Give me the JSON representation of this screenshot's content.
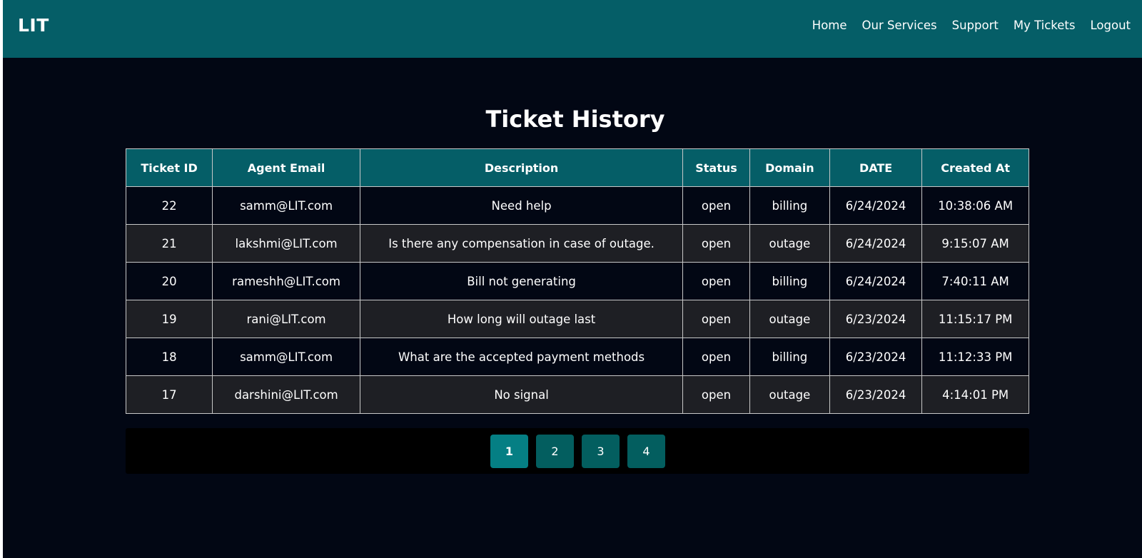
{
  "header": {
    "brand": "LIT",
    "nav": [
      "Home",
      "Our Services",
      "Support",
      "My Tickets",
      "Logout"
    ]
  },
  "main": {
    "title": "Ticket History",
    "columns": [
      "Ticket ID",
      "Agent Email",
      "Description",
      "Status",
      "Domain",
      "DATE",
      "Created At"
    ],
    "rows": [
      [
        "22",
        "samm@LIT.com",
        "Need help",
        "open",
        "billing",
        "6/24/2024",
        "10:38:06 AM"
      ],
      [
        "21",
        "lakshmi@LIT.com",
        "Is there any compensation in case of outage.",
        "open",
        "outage",
        "6/24/2024",
        "9:15:07 AM"
      ],
      [
        "20",
        "rameshh@LIT.com",
        "Bill not generating",
        "open",
        "billing",
        "6/24/2024",
        "7:40:11 AM"
      ],
      [
        "19",
        "rani@LIT.com",
        "How long will outage last",
        "open",
        "outage",
        "6/23/2024",
        "11:15:17 PM"
      ],
      [
        "18",
        "samm@LIT.com",
        "What are the accepted payment methods",
        "open",
        "billing",
        "6/23/2024",
        "11:12:33 PM"
      ],
      [
        "17",
        "darshini@LIT.com",
        "No signal",
        "open",
        "outage",
        "6/23/2024",
        "4:14:01 PM"
      ]
    ]
  },
  "pagination": {
    "pages": [
      "1",
      "2",
      "3",
      "4"
    ],
    "active": "1"
  },
  "colors": {
    "navbar": "#055e67",
    "background": "#020714",
    "row_alt": "#1e1f24",
    "page_button": "#035e5f",
    "page_button_active": "#057f84"
  }
}
